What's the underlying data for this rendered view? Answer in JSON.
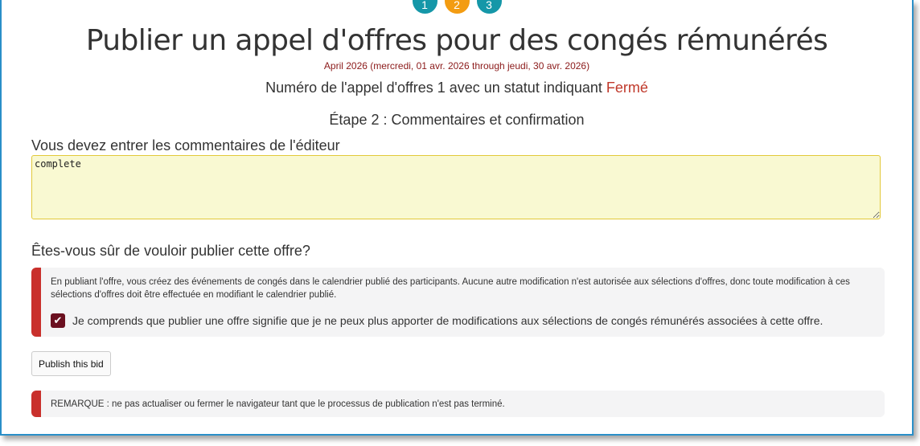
{
  "steps": [
    {
      "label": "1",
      "state": "done",
      "color": "#1597a8"
    },
    {
      "label": "2",
      "state": "current",
      "color": "#f39c12"
    },
    {
      "label": "3",
      "state": "upcoming",
      "color": "#1597a8"
    }
  ],
  "header": {
    "title": "Publier un appel d'offres pour des congés rémunérés",
    "date_range": "April 2026 (mercredi, 01 avr. 2026 through jeudi, 30 avr. 2026)",
    "bid_prefix": "Numéro de l'appel d'offres 1 avec un statut indiquant",
    "bid_status": "Fermé",
    "step_title": "Étape 2 : Commentaires et confirmation"
  },
  "comments": {
    "label": "Vous devez entrer les commentaires de l'éditeur",
    "value": "complete"
  },
  "confirm": {
    "question": "Êtes-vous sûr de vouloir publier cette offre?",
    "info": "En publiant l'offre, vous créez des événements de congés dans le calendrier publié des participants. Aucune autre modification n'est autorisée aux sélections d'offres, donc toute modification à ces sélections d'offres doit être effectuée en modifiant le calendrier publié.",
    "ack_checked": true,
    "ack_label": "Je comprends que publier une offre signifie que je ne peux plus apporter de modifications aux sélections de congés rémunérés associées à cette offre."
  },
  "actions": {
    "publish_label": "Publish this bid"
  },
  "notice": {
    "text": "REMARQUE : ne pas actualiser ou fermer le navigateur tant que le processus de publication n'est pas terminé."
  },
  "colors": {
    "accent_blue": "#1597a8",
    "accent_orange": "#f39c12",
    "status_red": "#c0392b",
    "callout_border": "#c9302c",
    "textarea_bg": "#f9f9d2"
  }
}
